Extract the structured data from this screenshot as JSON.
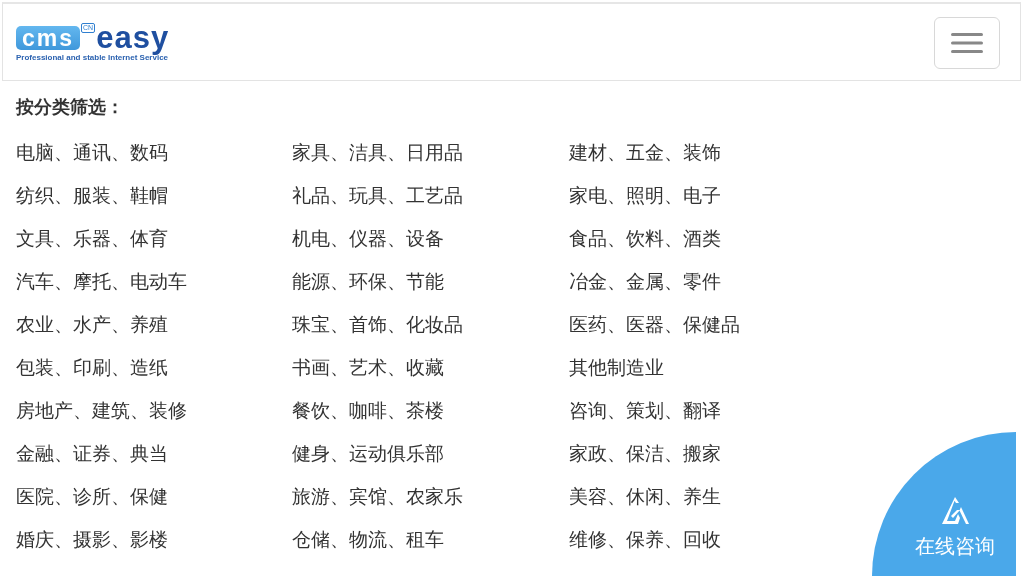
{
  "header": {
    "logo": {
      "boxed_text": "cms",
      "badge": "CN",
      "text": "easy",
      "tagline": "Professional and stable Internet Service"
    },
    "menu_button": {
      "expanded": false
    }
  },
  "filter": {
    "title": "按分类筛选：",
    "categories": [
      "电脑、通讯、数码",
      "家具、洁具、日用品",
      "建材、五金、装饰",
      "纺织、服装、鞋帽",
      "礼品、玩具、工艺品",
      "家电、照明、电子",
      "文具、乐器、体育",
      "机电、仪器、设备",
      "食品、饮料、酒类",
      "汽车、摩托、电动车",
      "能源、环保、节能",
      "冶金、金属、零件",
      "农业、水产、养殖",
      "珠宝、首饰、化妆品",
      "医药、医器、保健品",
      "包装、印刷、造纸",
      "书画、艺术、收藏",
      "其他制造业",
      "房地产、建筑、装修",
      "餐饮、咖啡、茶楼",
      "咨询、策划、翻译",
      "金融、证券、典当",
      "健身、运动俱乐部",
      "家政、保洁、搬家",
      "医院、诊所、保健",
      "旅游、宾馆、农家乐",
      "美容、休闲、养生",
      "婚庆、摄影、影楼",
      "仓储、物流、租车",
      "维修、保养、回收"
    ]
  },
  "consult_button": {
    "label": "在线咨询"
  }
}
